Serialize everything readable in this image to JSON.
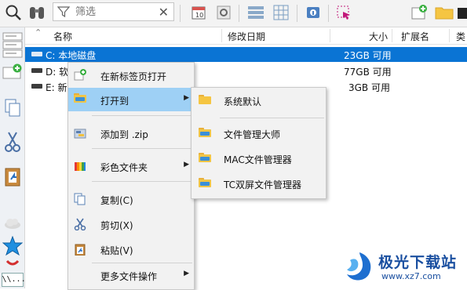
{
  "toolbar": {
    "filter_placeholder": "筛选",
    "clear_glyph": "✕",
    "icons": [
      "search-icon",
      "binoculars-icon",
      "filter-icon",
      "clear-icon",
      "calendar-icon",
      "gear-icon",
      "details-view-icon",
      "grid-view-icon",
      "properties-icon",
      "select-icon",
      "new-item-icon",
      "folder-icon"
    ]
  },
  "leftbar": {
    "tab_text": "\\\\...",
    "icons": [
      "tabs-icon",
      "add-tab-icon",
      "copy-icon",
      "cut-icon",
      "paste-icon",
      "cloud-icon",
      "star-icon",
      "remove-icon"
    ]
  },
  "columns": {
    "name": "名称",
    "modified": "修改日期",
    "size": "大小",
    "ext": "扩展名",
    "partial": "类"
  },
  "rows": [
    {
      "name": "C: 本地磁盘",
      "size": "23GB 可用",
      "selected": true
    },
    {
      "name": "D: 软",
      "size": "77GB 可用",
      "selected": false
    },
    {
      "name": "E: 新",
      "size": "3GB 可用",
      "selected": false
    }
  ],
  "context_menu": {
    "items": [
      {
        "label": "在新标签页打开",
        "icon": "new-tab-icon"
      },
      {
        "label": "打开到",
        "icon": "open-to-icon",
        "submenu": true
      },
      {
        "label": "添加到 .zip",
        "icon": "zip-icon"
      },
      {
        "label": "彩色文件夹",
        "icon": "color-folder-icon",
        "submenu": true
      },
      {
        "label": "复制(C)",
        "icon": "copy-icon"
      },
      {
        "label": "剪切(X)",
        "icon": "cut-icon"
      },
      {
        "label": "粘贴(V)",
        "icon": "paste-icon"
      },
      {
        "label": "更多文件操作",
        "icon": "more-icon",
        "submenu": true
      }
    ]
  },
  "submenu": {
    "items": [
      {
        "label": "系统默认"
      },
      {
        "label": "文件管理大师"
      },
      {
        "label": "MAC文件管理器"
      },
      {
        "label": "TC双屏文件管理器"
      }
    ]
  },
  "watermark": {
    "title": "极光下载站",
    "url": "www.xz7.com"
  },
  "colors": {
    "selection": "#0a74d4",
    "menu_highlight": "#9ed0f5",
    "watermark": "#1a4fa0"
  }
}
